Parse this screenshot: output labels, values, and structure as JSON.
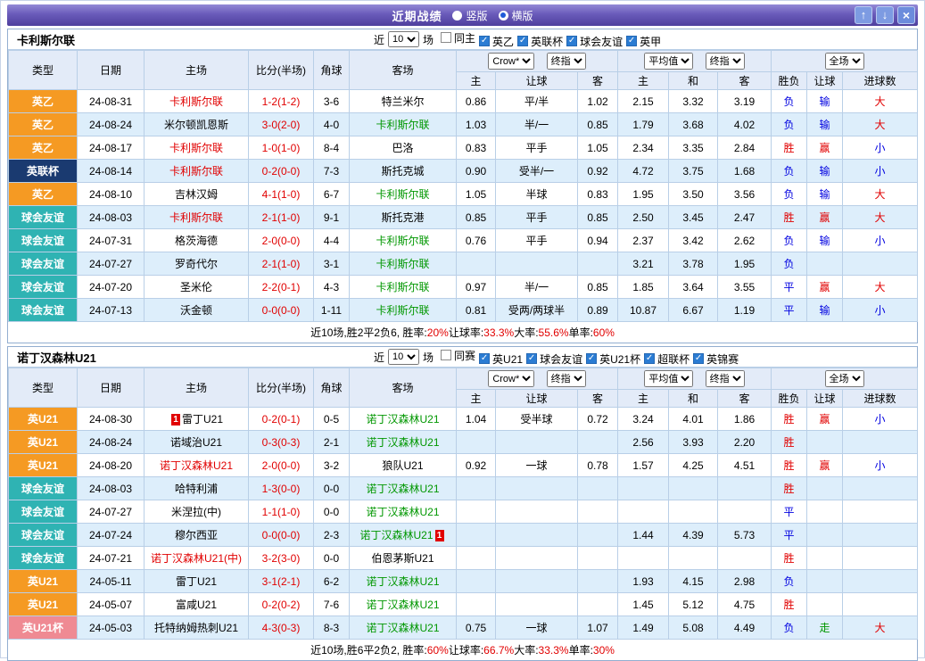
{
  "titlebar": {
    "title": "近期战绩",
    "radio_vertical": "竖版",
    "radio_horizontal": "横版",
    "btn_up": "↑",
    "btn_down": "↓",
    "btn_close": "×"
  },
  "columns": {
    "type": "类型",
    "date": "日期",
    "home": "主场",
    "score": "比分(半场)",
    "corner": "角球",
    "away": "客场",
    "asian_home": "主",
    "asian_hc": "让球",
    "asian_away": "客",
    "euro_home": "主",
    "euro_draw": "和",
    "euro_away": "客",
    "result": "胜负",
    "hc_result": "让球",
    "goals": "进球数"
  },
  "colors": {
    "accent_purple": "#4e3f9d",
    "header_bg": "#e3ebf8",
    "alt_row": "#ddeefb",
    "win_red": "#e10000",
    "lose_blue": "#0000e0",
    "walk_green": "#009700",
    "league2_orange": "#f59a23",
    "leaguecup_navy": "#1a3a70",
    "friendly_teal": "#2fb3b3",
    "u21cup_pink": "#ef8a93"
  },
  "sections": [
    {
      "team": "卡利斯尔联",
      "filters": {
        "near_label": "近",
        "near_value": "10",
        "games_label": "场",
        "checkboxes": [
          {
            "label": "同主",
            "checked": false
          },
          {
            "label": "英乙",
            "checked": true
          },
          {
            "label": "英联杯",
            "checked": true
          },
          {
            "label": "球会友谊",
            "checked": true
          },
          {
            "label": "英甲",
            "checked": true
          }
        ]
      },
      "selects": {
        "company": "Crow*",
        "company_time": "终指",
        "euro": "平均值",
        "euro_time": "终指",
        "scope": "全场"
      },
      "rows": [
        {
          "type": "英乙",
          "type_style": "orange",
          "date": "24-08-31",
          "home": "卡利斯尔联",
          "home_color": "red",
          "score": "1-2(1-2)",
          "corner": "3-6",
          "away": "特兰米尔",
          "away_color": "black",
          "ah": "0.86",
          "hc": "平/半",
          "aa": "1.02",
          "eh": "2.15",
          "ed": "3.32",
          "ea": "3.19",
          "result": "负",
          "result_color": "blue",
          "hres": "输",
          "hres_color": "blue",
          "goals": "大",
          "goals_color": "red"
        },
        {
          "type": "英乙",
          "type_style": "orange",
          "date": "24-08-24",
          "home": "米尔顿凯恩斯",
          "home_color": "black",
          "score": "3-0(2-0)",
          "corner": "4-0",
          "away": "卡利斯尔联",
          "away_color": "green",
          "ah": "1.03",
          "hc": "半/一",
          "aa": "0.85",
          "eh": "1.79",
          "ed": "3.68",
          "ea": "4.02",
          "result": "负",
          "result_color": "blue",
          "hres": "输",
          "hres_color": "blue",
          "goals": "大",
          "goals_color": "red"
        },
        {
          "type": "英乙",
          "type_style": "orange",
          "date": "24-08-17",
          "home": "卡利斯尔联",
          "home_color": "red",
          "score": "1-0(1-0)",
          "corner": "8-4",
          "away": "巴洛",
          "away_color": "black",
          "ah": "0.83",
          "hc": "平手",
          "aa": "1.05",
          "eh": "2.34",
          "ed": "3.35",
          "ea": "2.84",
          "result": "胜",
          "result_color": "red",
          "hres": "赢",
          "hres_color": "red",
          "goals": "小",
          "goals_color": "blue"
        },
        {
          "type": "英联杯",
          "type_style": "navy",
          "date": "24-08-14",
          "home": "卡利斯尔联",
          "home_color": "red",
          "score": "0-2(0-0)",
          "corner": "7-3",
          "away": "斯托克城",
          "away_color": "black",
          "ah": "0.90",
          "hc": "受半/一",
          "aa": "0.92",
          "eh": "4.72",
          "ed": "3.75",
          "ea": "1.68",
          "result": "负",
          "result_color": "blue",
          "hres": "输",
          "hres_color": "blue",
          "goals": "小",
          "goals_color": "blue"
        },
        {
          "type": "英乙",
          "type_style": "orange",
          "date": "24-08-10",
          "home": "吉林汉姆",
          "home_color": "black",
          "score": "4-1(1-0)",
          "corner": "6-7",
          "away": "卡利斯尔联",
          "away_color": "green",
          "ah": "1.05",
          "hc": "半球",
          "aa": "0.83",
          "eh": "1.95",
          "ed": "3.50",
          "ea": "3.56",
          "result": "负",
          "result_color": "blue",
          "hres": "输",
          "hres_color": "blue",
          "goals": "大",
          "goals_color": "red"
        },
        {
          "type": "球会友谊",
          "type_style": "teal",
          "date": "24-08-03",
          "home": "卡利斯尔联",
          "home_color": "red",
          "score": "2-1(1-0)",
          "corner": "9-1",
          "away": "斯托克港",
          "away_color": "black",
          "ah": "0.85",
          "hc": "平手",
          "aa": "0.85",
          "eh": "2.50",
          "ed": "3.45",
          "ea": "2.47",
          "result": "胜",
          "result_color": "red",
          "hres": "赢",
          "hres_color": "red",
          "goals": "大",
          "goals_color": "red"
        },
        {
          "type": "球会友谊",
          "type_style": "teal",
          "date": "24-07-31",
          "home": "格茨海德",
          "home_color": "black",
          "score": "2-0(0-0)",
          "corner": "4-4",
          "away": "卡利斯尔联",
          "away_color": "green",
          "ah": "0.76",
          "hc": "平手",
          "aa": "0.94",
          "eh": "2.37",
          "ed": "3.42",
          "ea": "2.62",
          "result": "负",
          "result_color": "blue",
          "hres": "输",
          "hres_color": "blue",
          "goals": "小",
          "goals_color": "blue"
        },
        {
          "type": "球会友谊",
          "type_style": "teal",
          "date": "24-07-27",
          "home": "罗奇代尔",
          "home_color": "black",
          "score": "2-1(1-0)",
          "corner": "3-1",
          "away": "卡利斯尔联",
          "away_color": "green",
          "ah": "",
          "hc": "",
          "aa": "",
          "eh": "3.21",
          "ed": "3.78",
          "ea": "1.95",
          "result": "负",
          "result_color": "blue",
          "hres": "",
          "hres_color": "black",
          "goals": "",
          "goals_color": "black"
        },
        {
          "type": "球会友谊",
          "type_style": "teal",
          "date": "24-07-20",
          "home": "圣米伦",
          "home_color": "black",
          "score": "2-2(0-1)",
          "corner": "4-3",
          "away": "卡利斯尔联",
          "away_color": "green",
          "ah": "0.97",
          "hc": "半/一",
          "aa": "0.85",
          "eh": "1.85",
          "ed": "3.64",
          "ea": "3.55",
          "result": "平",
          "result_color": "blue",
          "hres": "赢",
          "hres_color": "red",
          "goals": "大",
          "goals_color": "red"
        },
        {
          "type": "球会友谊",
          "type_style": "teal",
          "date": "24-07-13",
          "home": "沃金顿",
          "home_color": "black",
          "score": "0-0(0-0)",
          "corner": "1-11",
          "away": "卡利斯尔联",
          "away_color": "green",
          "ah": "0.81",
          "hc": "受两/两球半",
          "aa": "0.89",
          "eh": "10.87",
          "ed": "6.67",
          "ea": "1.19",
          "result": "平",
          "result_color": "blue",
          "hres": "输",
          "hres_color": "blue",
          "goals": "小",
          "goals_color": "blue"
        }
      ],
      "summary": [
        {
          "text": "近10场,胜2平2负6, 胜率:",
          "color": "black"
        },
        {
          "text": "20%",
          "color": "red"
        },
        {
          "text": " 让球率:",
          "color": "black"
        },
        {
          "text": "33.3%",
          "color": "red"
        },
        {
          "text": " 大率:",
          "color": "black"
        },
        {
          "text": "55.6%",
          "color": "red"
        },
        {
          "text": " 单率:",
          "color": "black"
        },
        {
          "text": "60%",
          "color": "red"
        }
      ]
    },
    {
      "team": "诺丁汉森林U21",
      "filters": {
        "near_label": "近",
        "near_value": "10",
        "games_label": "场",
        "checkboxes": [
          {
            "label": "同赛",
            "checked": false
          },
          {
            "label": "英U21",
            "checked": true
          },
          {
            "label": "球会友谊",
            "checked": true
          },
          {
            "label": "英U21杯",
            "checked": true
          },
          {
            "label": "超联杯",
            "checked": true
          },
          {
            "label": "英锦赛",
            "checked": true
          }
        ]
      },
      "selects": {
        "company": "Crow*",
        "company_time": "终指",
        "euro": "平均值",
        "euro_time": "终指",
        "scope": "全场"
      },
      "rows": [
        {
          "type": "英U21",
          "type_style": "orange",
          "date": "24-08-30",
          "home": "雷丁U21",
          "home_color": "black",
          "home_card": "1",
          "score": "0-2(0-1)",
          "corner": "0-5",
          "away": "诺丁汉森林U21",
          "away_color": "green",
          "ah": "1.04",
          "hc": "受半球",
          "aa": "0.72",
          "eh": "3.24",
          "ed": "4.01",
          "ea": "1.86",
          "result": "胜",
          "result_color": "red",
          "hres": "赢",
          "hres_color": "red",
          "goals": "小",
          "goals_color": "blue"
        },
        {
          "type": "英U21",
          "type_style": "orange",
          "date": "24-08-24",
          "home": "诺域治U21",
          "home_color": "black",
          "score": "0-3(0-3)",
          "corner": "2-1",
          "away": "诺丁汉森林U21",
          "away_color": "green",
          "ah": "",
          "hc": "",
          "aa": "",
          "eh": "2.56",
          "ed": "3.93",
          "ea": "2.20",
          "result": "胜",
          "result_color": "red",
          "hres": "",
          "hres_color": "black",
          "goals": "",
          "goals_color": "black"
        },
        {
          "type": "英U21",
          "type_style": "orange",
          "date": "24-08-20",
          "home": "诺丁汉森林U21",
          "home_color": "red",
          "score": "2-0(0-0)",
          "corner": "3-2",
          "away": "狼队U21",
          "away_color": "black",
          "ah": "0.92",
          "hc": "一球",
          "aa": "0.78",
          "eh": "1.57",
          "ed": "4.25",
          "ea": "4.51",
          "result": "胜",
          "result_color": "red",
          "hres": "赢",
          "hres_color": "red",
          "goals": "小",
          "goals_color": "blue"
        },
        {
          "type": "球会友谊",
          "type_style": "teal",
          "date": "24-08-03",
          "home": "哈特利浦",
          "home_color": "black",
          "score": "1-3(0-0)",
          "corner": "0-0",
          "away": "诺丁汉森林U21",
          "away_color": "green",
          "ah": "",
          "hc": "",
          "aa": "",
          "eh": "",
          "ed": "",
          "ea": "",
          "result": "胜",
          "result_color": "red",
          "hres": "",
          "hres_color": "black",
          "goals": "",
          "goals_color": "black"
        },
        {
          "type": "球会友谊",
          "type_style": "teal",
          "date": "24-07-27",
          "home": "米涅拉(中)",
          "home_color": "black",
          "score": "1-1(1-0)",
          "corner": "0-0",
          "away": "诺丁汉森林U21",
          "away_color": "green",
          "ah": "",
          "hc": "",
          "aa": "",
          "eh": "",
          "ed": "",
          "ea": "",
          "result": "平",
          "result_color": "blue",
          "hres": "",
          "hres_color": "black",
          "goals": "",
          "goals_color": "black"
        },
        {
          "type": "球会友谊",
          "type_style": "teal",
          "date": "24-07-24",
          "home": "穆尔西亚",
          "home_color": "black",
          "score": "0-0(0-0)",
          "corner": "2-3",
          "away": "诺丁汉森林U21",
          "away_color": "green",
          "away_card": "1",
          "ah": "",
          "hc": "",
          "aa": "",
          "eh": "1.44",
          "ed": "4.39",
          "ea": "5.73",
          "result": "平",
          "result_color": "blue",
          "hres": "",
          "hres_color": "black",
          "goals": "",
          "goals_color": "black"
        },
        {
          "type": "球会友谊",
          "type_style": "teal",
          "date": "24-07-21",
          "home": "诺丁汉森林U21(中)",
          "home_color": "red",
          "score": "3-2(3-0)",
          "corner": "0-0",
          "away": "伯恩茅斯U21",
          "away_color": "black",
          "ah": "",
          "hc": "",
          "aa": "",
          "eh": "",
          "ed": "",
          "ea": "",
          "result": "胜",
          "result_color": "red",
          "hres": "",
          "hres_color": "black",
          "goals": "",
          "goals_color": "black"
        },
        {
          "type": "英U21",
          "type_style": "orange",
          "date": "24-05-11",
          "home": "雷丁U21",
          "home_color": "black",
          "score": "3-1(2-1)",
          "corner": "6-2",
          "away": "诺丁汉森林U21",
          "away_color": "green",
          "ah": "",
          "hc": "",
          "aa": "",
          "eh": "1.93",
          "ed": "4.15",
          "ea": "2.98",
          "result": "负",
          "result_color": "blue",
          "hres": "",
          "hres_color": "black",
          "goals": "",
          "goals_color": "black"
        },
        {
          "type": "英U21",
          "type_style": "orange",
          "date": "24-05-07",
          "home": "富咸U21",
          "home_color": "black",
          "score": "0-2(0-2)",
          "corner": "7-6",
          "away": "诺丁汉森林U21",
          "away_color": "green",
          "ah": "",
          "hc": "",
          "aa": "",
          "eh": "1.45",
          "ed": "5.12",
          "ea": "4.75",
          "result": "胜",
          "result_color": "red",
          "hres": "",
          "hres_color": "black",
          "goals": "",
          "goals_color": "black"
        },
        {
          "type": "英U21杯",
          "type_style": "pink",
          "date": "24-05-03",
          "home": "托特纳姆热刺U21",
          "home_color": "black",
          "score": "4-3(0-3)",
          "corner": "8-3",
          "away": "诺丁汉森林U21",
          "away_color": "green",
          "ah": "0.75",
          "hc": "一球",
          "aa": "1.07",
          "eh": "1.49",
          "ed": "5.08",
          "ea": "4.49",
          "result": "负",
          "result_color": "blue",
          "hres": "走",
          "hres_color": "green",
          "goals": "大",
          "goals_color": "red"
        }
      ],
      "summary": [
        {
          "text": "近10场,胜6平2负2, 胜率:",
          "color": "black"
        },
        {
          "text": "60%",
          "color": "red"
        },
        {
          "text": " 让球率:",
          "color": "black"
        },
        {
          "text": "66.7%",
          "color": "red"
        },
        {
          "text": " 大率:",
          "color": "black"
        },
        {
          "text": "33.3%",
          "color": "red"
        },
        {
          "text": " 单率:",
          "color": "black"
        },
        {
          "text": "30%",
          "color": "red"
        }
      ]
    }
  ]
}
